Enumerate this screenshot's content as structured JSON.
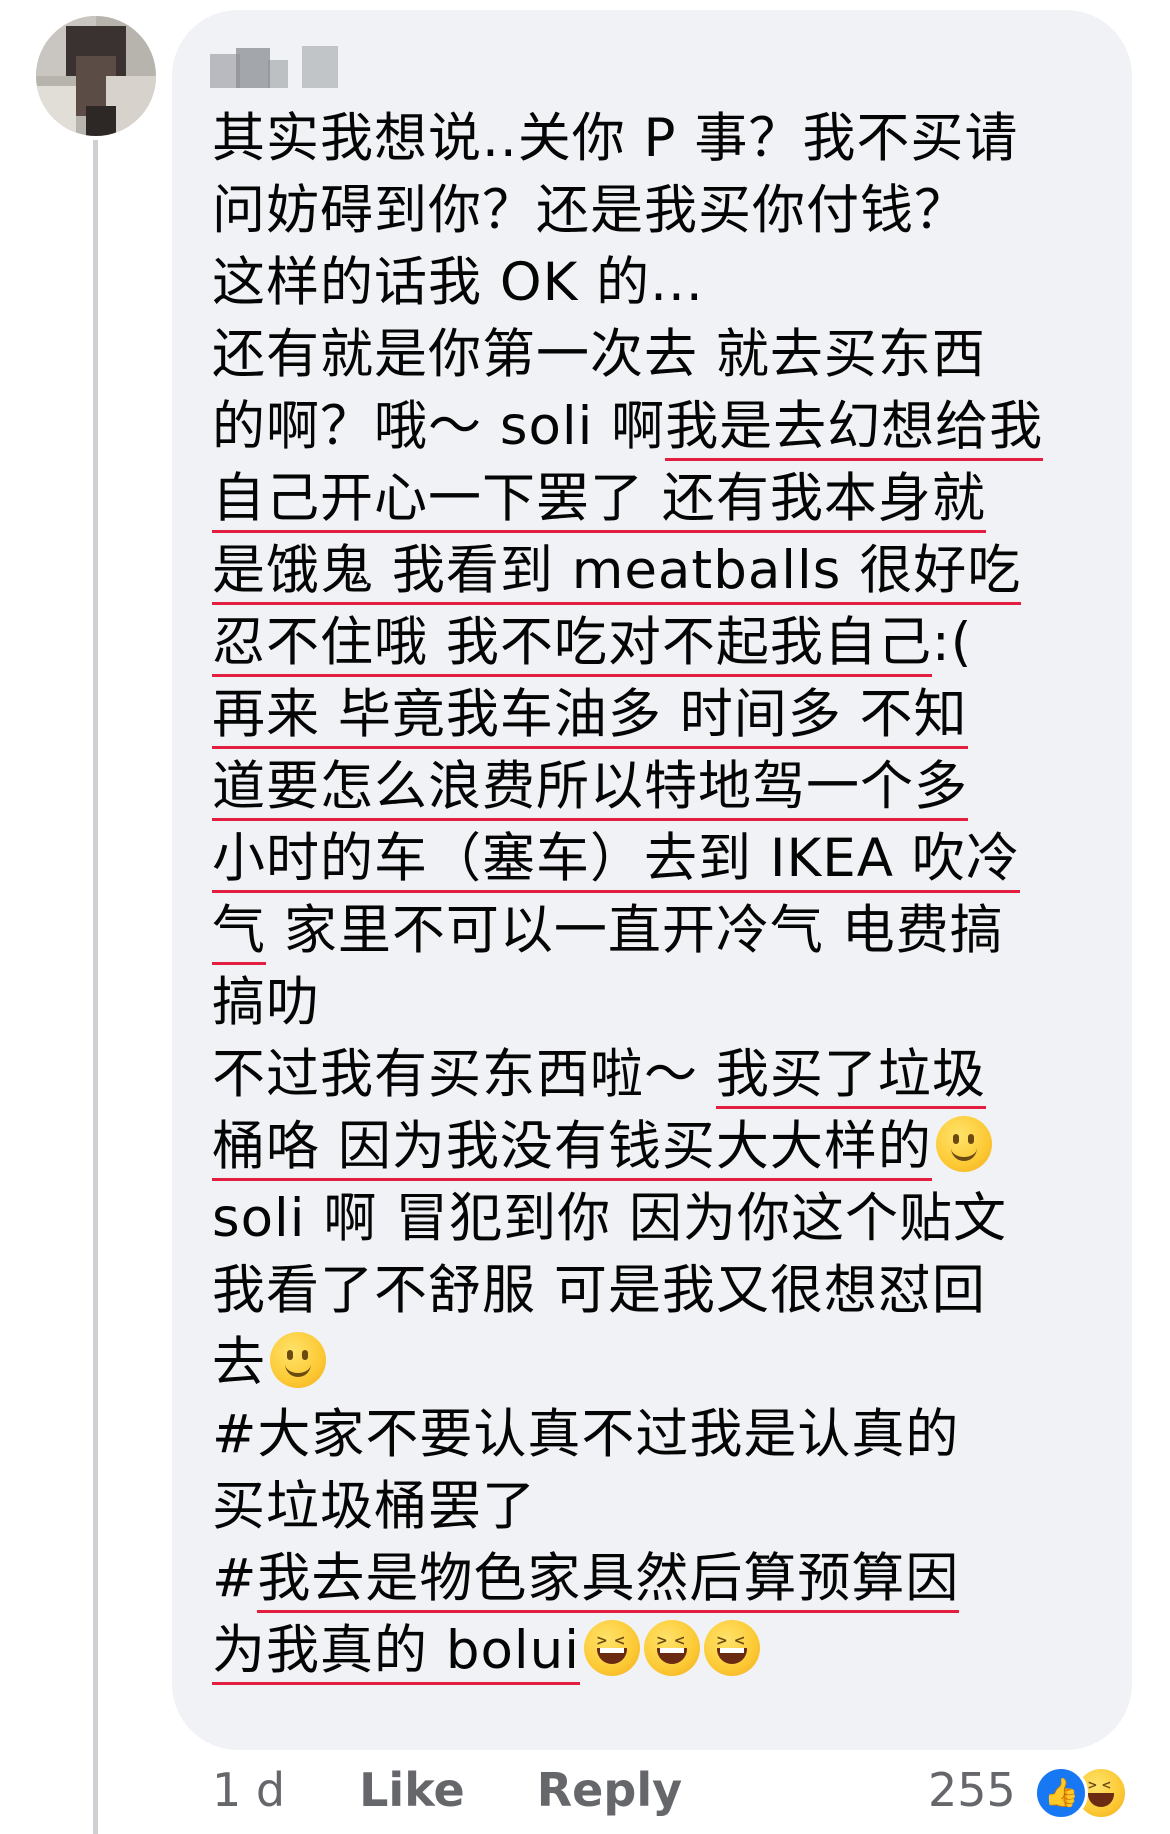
{
  "comment": {
    "lines": [
      {
        "segments": [
          {
            "text": "其实我想说..关你 P 事？我不买请",
            "hl": false
          }
        ]
      },
      {
        "segments": [
          {
            "text": "问妨碍到你？还是我买你付钱？",
            "hl": false
          }
        ]
      },
      {
        "segments": [
          {
            "text": "这样的话我 OK 的...",
            "hl": false
          }
        ]
      },
      {
        "segments": [
          {
            "text": "还有就是你第一次去 就去买东西",
            "hl": false
          }
        ]
      },
      {
        "segments": [
          {
            "text": "的啊？哦～ soli 啊",
            "hl": false
          },
          {
            "text": "我是去幻想给我",
            "hl": true
          }
        ]
      },
      {
        "segments": [
          {
            "text": "自己开心一下罢了 还有我本身就",
            "hl": true
          }
        ]
      },
      {
        "segments": [
          {
            "text": "是饿鬼 我看到 meatballs 很好吃",
            "hl": true
          }
        ]
      },
      {
        "segments": [
          {
            "text": "忍不住哦 我不吃对不起我自己",
            "hl": true
          },
          {
            "text": ":(",
            "hl": false
          }
        ]
      },
      {
        "segments": [
          {
            "text": "再来 毕竟我车油多 时间多 不知",
            "hl": true
          }
        ]
      },
      {
        "segments": [
          {
            "text": "道要怎么浪费所以特地驾一个多",
            "hl": true
          }
        ]
      },
      {
        "segments": [
          {
            "text": "小时的车（塞车）去到 IKEA 吹冷",
            "hl": true
          }
        ]
      },
      {
        "segments": [
          {
            "text": "气",
            "hl": true
          },
          {
            "text": " 家里不可以一直开冷气 电费搞",
            "hl": false
          }
        ]
      },
      {
        "segments": [
          {
            "text": "搞叻",
            "hl": false
          }
        ]
      },
      {
        "segments": [
          {
            "text": "不过我有买东西啦～ ",
            "hl": false
          },
          {
            "text": "我买了垃圾",
            "hl": true
          }
        ]
      },
      {
        "segments": [
          {
            "text": "桶咯 因为我没有钱买大大样的",
            "hl": true
          }
        ],
        "emoji": [
          "smile"
        ]
      },
      {
        "segments": [
          {
            "text": "soli 啊 冒犯到你 因为你这个贴文",
            "hl": false
          }
        ]
      },
      {
        "segments": [
          {
            "text": "我看了不舒服 可是我又很想怼回",
            "hl": false
          }
        ]
      },
      {
        "segments": [
          {
            "text": "去",
            "hl": false
          }
        ],
        "emoji": [
          "smile"
        ]
      },
      {
        "segments": [
          {
            "text": "#大家不要认真不过我是认真的",
            "hl": false
          }
        ]
      },
      {
        "segments": [
          {
            "text": "买垃圾桶罢了",
            "hl": false
          }
        ]
      },
      {
        "segments": [
          {
            "text": "#",
            "hl": false
          },
          {
            "text": "我去是物色家具然后算预算因",
            "hl": true
          }
        ]
      },
      {
        "segments": [
          {
            "text": "为我真的 bolui",
            "hl": true
          }
        ],
        "emoji": [
          "laugh",
          "laugh",
          "laugh"
        ]
      }
    ]
  },
  "actions": {
    "time": "1 d",
    "like": "Like",
    "reply": "Reply"
  },
  "reactions": {
    "count": "255",
    "icons": [
      "like-icon",
      "haha-icon"
    ]
  },
  "colors": {
    "bubble": "#f0f2f5",
    "underline": "#e41e3f",
    "meta": "#65676b",
    "like_blue": "#1877f2"
  }
}
